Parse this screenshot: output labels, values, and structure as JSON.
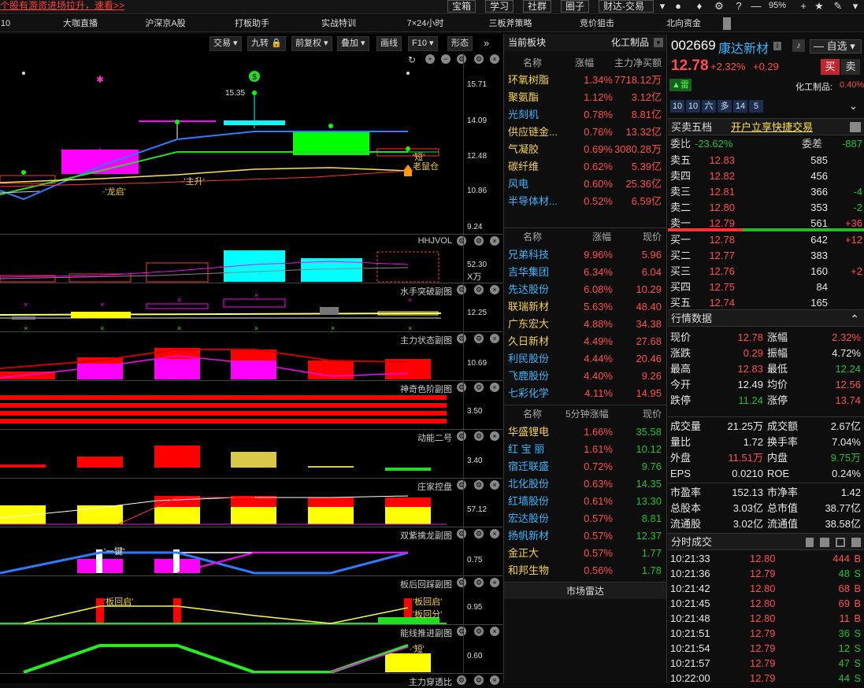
{
  "topbar": {
    "ticker": "个股有游资进场拉升，速看>>",
    "buttons": [
      "宝箱",
      "学习",
      "社群",
      "圈子",
      "财达-交易"
    ],
    "zoom": "95%"
  },
  "nav": [
    "10",
    "大咖直播",
    "沪深京A股",
    "打板助手",
    "实战特训",
    "7×24小时",
    "三板斧策略",
    "竞价狙击",
    "北向资金"
  ],
  "toolbar": {
    "trade": "交易",
    "jiuzhuan": "九转",
    "fq": "前复权",
    "overlay": "叠加",
    "draw": "画线",
    "f10": "F10",
    "shape": "形态"
  },
  "main": {
    "axis": [
      "15.71",
      "14.09",
      "12.48",
      "10.86",
      "9.24"
    ],
    "peak": "15.35",
    "labels": {
      "longqi": "·'龙启'",
      "zhusheng": "·'主升'",
      "duan": "'短'",
      "laoshu": "老鼠仓"
    }
  },
  "panes": [
    {
      "title": "HHJVOL",
      "value": "52.30",
      "unit": "X万"
    },
    {
      "title": "水手突破副图",
      "value": "12.25"
    },
    {
      "title": "主力状态副图",
      "value": "10.69"
    },
    {
      "title": "神奇色阶副图",
      "value": "3.50"
    },
    {
      "title": "动能二号",
      "value": "3.40"
    },
    {
      "title": "庄家控盘",
      "value": "57.12"
    },
    {
      "title": "双紫擒龙副图",
      "value": "0.75",
      "label": "'一键'"
    },
    {
      "title": "板后回踩副图",
      "value": "0.95",
      "labels": [
        "'板回启'",
        "'板回启'",
        "'板回分'"
      ]
    },
    {
      "title": "能线推进副图",
      "value": "0.60",
      "label": "·'短'"
    },
    {
      "title": "主力穿透比"
    }
  ],
  "sector_panel": {
    "title": "当前板块",
    "right": "化工制品",
    "headers": [
      "名称",
      "涨幅",
      "主力净买额"
    ],
    "rows": [
      [
        "环氧树脂",
        "1.34%",
        "7718.12万"
      ],
      [
        "聚氨酯",
        "1.12%",
        "3.12亿"
      ],
      [
        "光刻机",
        "0.78%",
        "8.81亿"
      ],
      [
        "供应链金...",
        "0.76%",
        "13.32亿"
      ],
      [
        "气凝胶",
        "0.69%",
        "3080.28万"
      ],
      [
        "碳纤维",
        "0.62%",
        "5.39亿"
      ],
      [
        "风电",
        "0.60%",
        "25.36亿"
      ],
      [
        "半导体材...",
        "0.52%",
        "6.59亿"
      ]
    ]
  },
  "stock_list": {
    "headers": [
      "名称",
      "涨幅",
      "现价"
    ],
    "rows": [
      [
        "兄弟科技",
        "9.96%",
        "5.96"
      ],
      [
        "吉华集团",
        "6.34%",
        "6.04"
      ],
      [
        "先达股份",
        "6.08%",
        "10.29"
      ],
      [
        "联瑞新材",
        "5.63%",
        "48.40"
      ],
      [
        "广东宏大",
        "4.88%",
        "34.38"
      ],
      [
        "久日新材",
        "4.49%",
        "27.68"
      ],
      [
        "利民股份",
        "4.44%",
        "20.46"
      ],
      [
        "飞鹿股份",
        "4.40%",
        "9.26"
      ],
      [
        "七彩化学",
        "4.11%",
        "14.95"
      ]
    ]
  },
  "speed_list": {
    "headers": [
      "名称",
      "5分钟涨幅",
      "现价"
    ],
    "rows": [
      [
        "华盛锂电",
        "1.66%",
        "35.58"
      ],
      [
        "红 宝 丽",
        "1.61%",
        "10.12"
      ],
      [
        "宿迁联盛",
        "0.72%",
        "9.76"
      ],
      [
        "北化股份",
        "0.63%",
        "14.35"
      ],
      [
        "红墙股份",
        "0.61%",
        "13.30"
      ],
      [
        "宏达股份",
        "0.57%",
        "8.81"
      ],
      [
        "扬帆新材",
        "0.57%",
        "12.37"
      ],
      [
        "金正大",
        "0.57%",
        "1.77"
      ],
      [
        "和邦生物",
        "0.56%",
        "1.78"
      ]
    ]
  },
  "radar": "市场雷达",
  "stock": {
    "code": "002669",
    "name": "康达新材",
    "price": "12.78",
    "pct": "+2.32%",
    "chg": "+0.29",
    "buy": "买",
    "sell": "卖",
    "watch": "自选",
    "industry": "化工制品:",
    "industry_pct": "0.40%",
    "tags": [
      "10",
      "10",
      "六",
      "多",
      "14",
      "5"
    ],
    "lei": "雷"
  },
  "order_book": {
    "title": "买卖五档",
    "link": "开户立享快捷交易",
    "weibi_label": "委比",
    "weibi": "-23.62%",
    "weicha_label": "委差",
    "weicha": "-887",
    "sells": [
      [
        "卖五",
        "12.83",
        "585",
        ""
      ],
      [
        "卖四",
        "12.82",
        "456",
        ""
      ],
      [
        "卖三",
        "12.81",
        "366",
        "-4"
      ],
      [
        "卖二",
        "12.80",
        "353",
        "-2"
      ],
      [
        "卖一",
        "12.79",
        "561",
        "+36"
      ]
    ],
    "buys": [
      [
        "买一",
        "12.78",
        "642",
        "+12"
      ],
      [
        "买二",
        "12.77",
        "383",
        ""
      ],
      [
        "买三",
        "12.76",
        "160",
        "+2"
      ],
      [
        "买四",
        "12.75",
        "84",
        ""
      ],
      [
        "买五",
        "12.74",
        "165",
        ""
      ]
    ]
  },
  "quote": {
    "title": "行情数据",
    "rows": [
      [
        "现价",
        "12.78",
        "涨幅",
        "2.32%"
      ],
      [
        "涨跌",
        "0.29",
        "振幅",
        "4.72%"
      ],
      [
        "最高",
        "12.83",
        "最低",
        "12.24"
      ],
      [
        "今开",
        "12.49",
        "均价",
        "12.56"
      ],
      [
        "跌停",
        "11.24",
        "涨停",
        "13.74"
      ]
    ],
    "rows2": [
      [
        "成交量",
        "21.25万",
        "成交额",
        "2.67亿"
      ],
      [
        "量比",
        "1.72",
        "换手率",
        "7.04%"
      ],
      [
        "外盘",
        "11.51万",
        "内盘",
        "9.75万"
      ],
      [
        "EPS",
        "0.0210",
        "ROE",
        "0.24%"
      ]
    ],
    "rows3": [
      [
        "市盈率",
        "152.13",
        "市净率",
        "1.42"
      ],
      [
        "总股本",
        "3.03亿",
        "总市值",
        "38.77亿"
      ],
      [
        "流通股",
        "3.02亿",
        "流通值",
        "38.58亿"
      ]
    ]
  },
  "ticks": {
    "title": "分时成交",
    "rows": [
      [
        "10:21:33",
        "12.80",
        "444",
        "B"
      ],
      [
        "10:21:36",
        "12.79",
        "48",
        "S"
      ],
      [
        "10:21:42",
        "12.80",
        "68",
        "B"
      ],
      [
        "10:21:45",
        "12.80",
        "69",
        "B"
      ],
      [
        "10:21:48",
        "12.80",
        "11",
        "B"
      ],
      [
        "10:21:51",
        "12.79",
        "36",
        "S"
      ],
      [
        "10:21:54",
        "12.79",
        "12",
        "S"
      ],
      [
        "10:21:57",
        "12.79",
        "47",
        "S"
      ],
      [
        "10:22:00",
        "12.79",
        "44",
        "S"
      ]
    ]
  }
}
